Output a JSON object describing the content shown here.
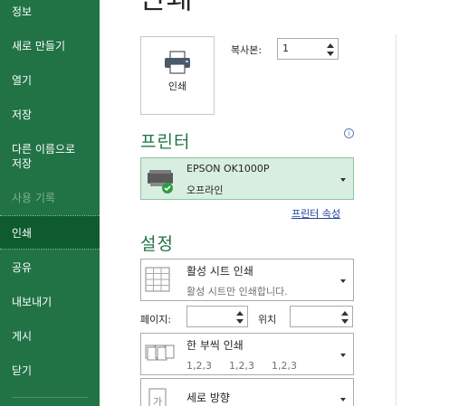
{
  "sidebar": {
    "items": [
      {
        "label": "정보",
        "state": "normal"
      },
      {
        "label": "새로 만들기",
        "state": "normal"
      },
      {
        "label": "열기",
        "state": "normal"
      },
      {
        "label": "저장",
        "state": "normal"
      },
      {
        "label": "다른 이름으로 저장",
        "line1": "다른 이름으로",
        "line2": "저장",
        "state": "normal"
      },
      {
        "label": "사용 기록",
        "state": "disabled"
      },
      {
        "label": "인쇄",
        "state": "active"
      },
      {
        "label": "공유",
        "state": "normal"
      },
      {
        "label": "내보내기",
        "state": "normal"
      },
      {
        "label": "게시",
        "state": "normal"
      },
      {
        "label": "닫기",
        "state": "normal"
      }
    ],
    "colors": {
      "background": "#217346",
      "active": "#0f5b30"
    }
  },
  "main": {
    "title": "인쇄",
    "print_button_label": "인쇄",
    "copies": {
      "label": "복사본:",
      "value": "1"
    },
    "printer_section": {
      "heading": "프린터",
      "info_icon": "i",
      "selected": {
        "name": "EPSON OK1000P",
        "status": "오프라인"
      },
      "properties_link": "프린터 속성"
    },
    "settings_section": {
      "heading": "설정",
      "scope": {
        "title": "활성 시트 인쇄",
        "subtitle": "활성 시트만 인쇄합니다."
      },
      "pages": {
        "label": "페이지:",
        "value": ""
      },
      "to": {
        "label": "위치",
        "value": ""
      },
      "collation": {
        "title": "한 부씩 인쇄",
        "sequence": [
          "1,2,3",
          "1,2,3",
          "1,2,3"
        ]
      },
      "orientation": {
        "title": "세로 방향"
      }
    }
  },
  "accent_color": "#217346"
}
